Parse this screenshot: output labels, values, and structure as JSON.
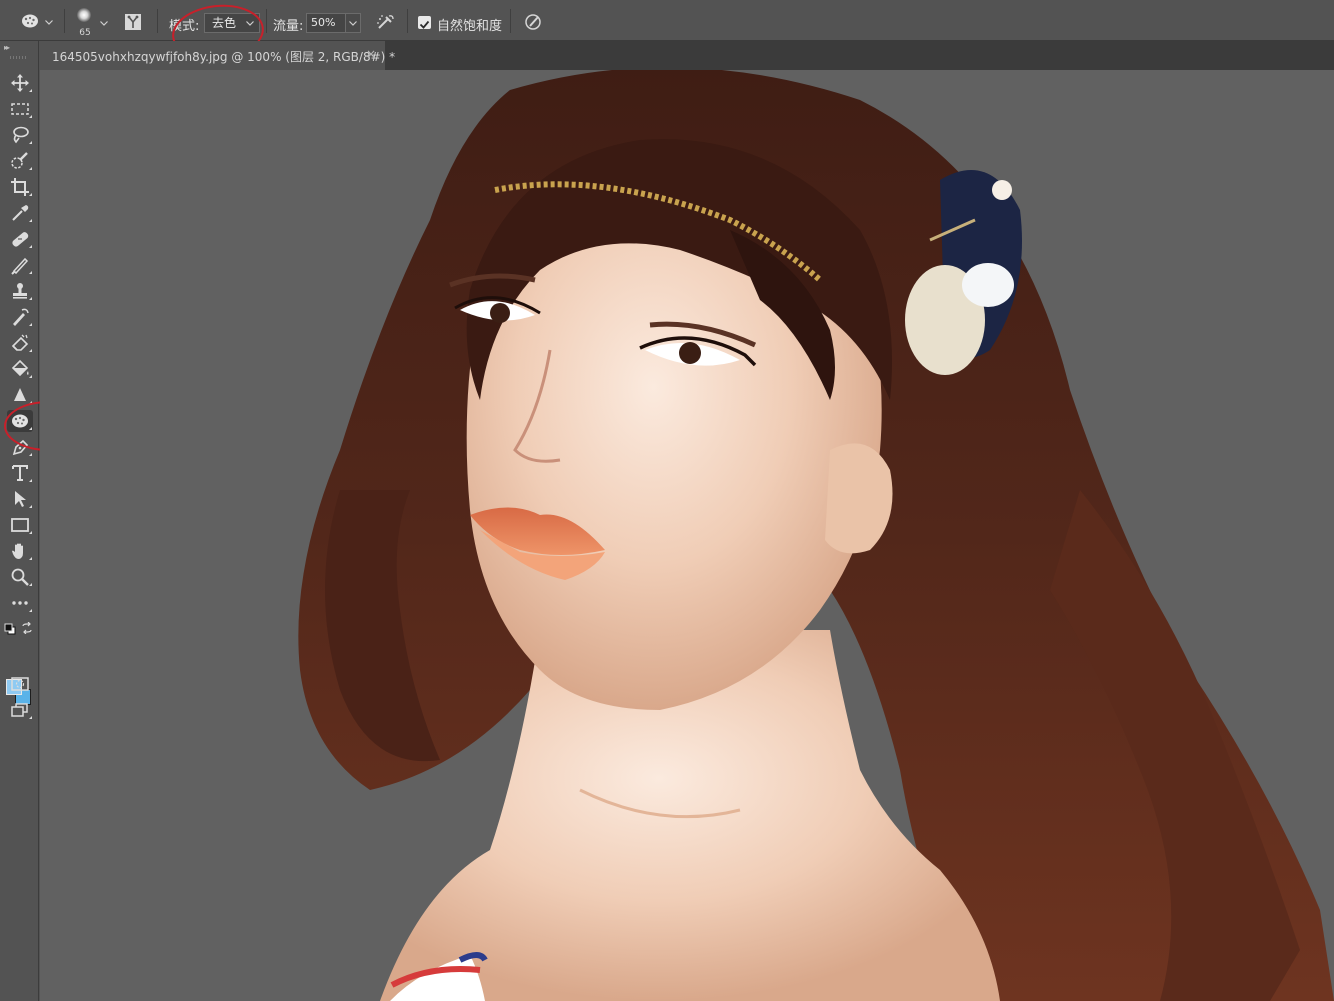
{
  "options_bar": {
    "brush_size": "65",
    "mode_label": "模式:",
    "mode_value": "去色",
    "flow_label": "流量:",
    "flow_value": "50%",
    "vibrance_label": "自然饱和度",
    "vibrance_checked": true
  },
  "document_tab": {
    "title": "164505vohxhzqywfjfoh8y.jpg @ 100% (图层 2, RGB/8#) *",
    "close": "×"
  },
  "toolbar": {
    "collapse_glyph": "▸▸",
    "tools": [
      {
        "name": "move-tool",
        "icon": "move-icon"
      },
      {
        "name": "marquee-tool",
        "icon": "marquee-icon"
      },
      {
        "name": "lasso-tool",
        "icon": "lasso-icon"
      },
      {
        "name": "quick-selection-tool",
        "icon": "quick-selection-icon"
      },
      {
        "name": "crop-tool",
        "icon": "crop-icon"
      },
      {
        "name": "eyedropper-tool",
        "icon": "eyedropper-icon"
      },
      {
        "name": "healing-brush-tool",
        "icon": "bandage-icon"
      },
      {
        "name": "brush-tool",
        "icon": "brush-icon"
      },
      {
        "name": "clone-stamp-tool",
        "icon": "stamp-icon"
      },
      {
        "name": "history-brush-tool",
        "icon": "history-brush-icon"
      },
      {
        "name": "eraser-tool",
        "icon": "eraser-icon"
      },
      {
        "name": "paint-bucket-tool",
        "icon": "bucket-icon"
      },
      {
        "name": "blur-tool",
        "icon": "blur-icon"
      },
      {
        "name": "sponge-tool",
        "icon": "sponge-icon",
        "active": true
      },
      {
        "name": "pen-tool",
        "icon": "pen-icon"
      },
      {
        "name": "type-tool",
        "icon": "type-icon"
      },
      {
        "name": "path-selection-tool",
        "icon": "path-selection-icon"
      },
      {
        "name": "rectangle-tool",
        "icon": "rectangle-icon"
      },
      {
        "name": "hand-tool",
        "icon": "hand-icon"
      },
      {
        "name": "zoom-tool",
        "icon": "zoom-icon"
      },
      {
        "name": "edit-toolbar",
        "icon": "more-icon"
      }
    ],
    "colors": {
      "foreground": "#8fcaf2",
      "background": "#5ab3e9"
    }
  },
  "theme": {
    "panel": "#535353",
    "tab_bar": "#3b3b3b",
    "canvas": "#616161",
    "annotation": "#c8202a"
  },
  "canvas": {
    "image": "portrait-photo"
  }
}
